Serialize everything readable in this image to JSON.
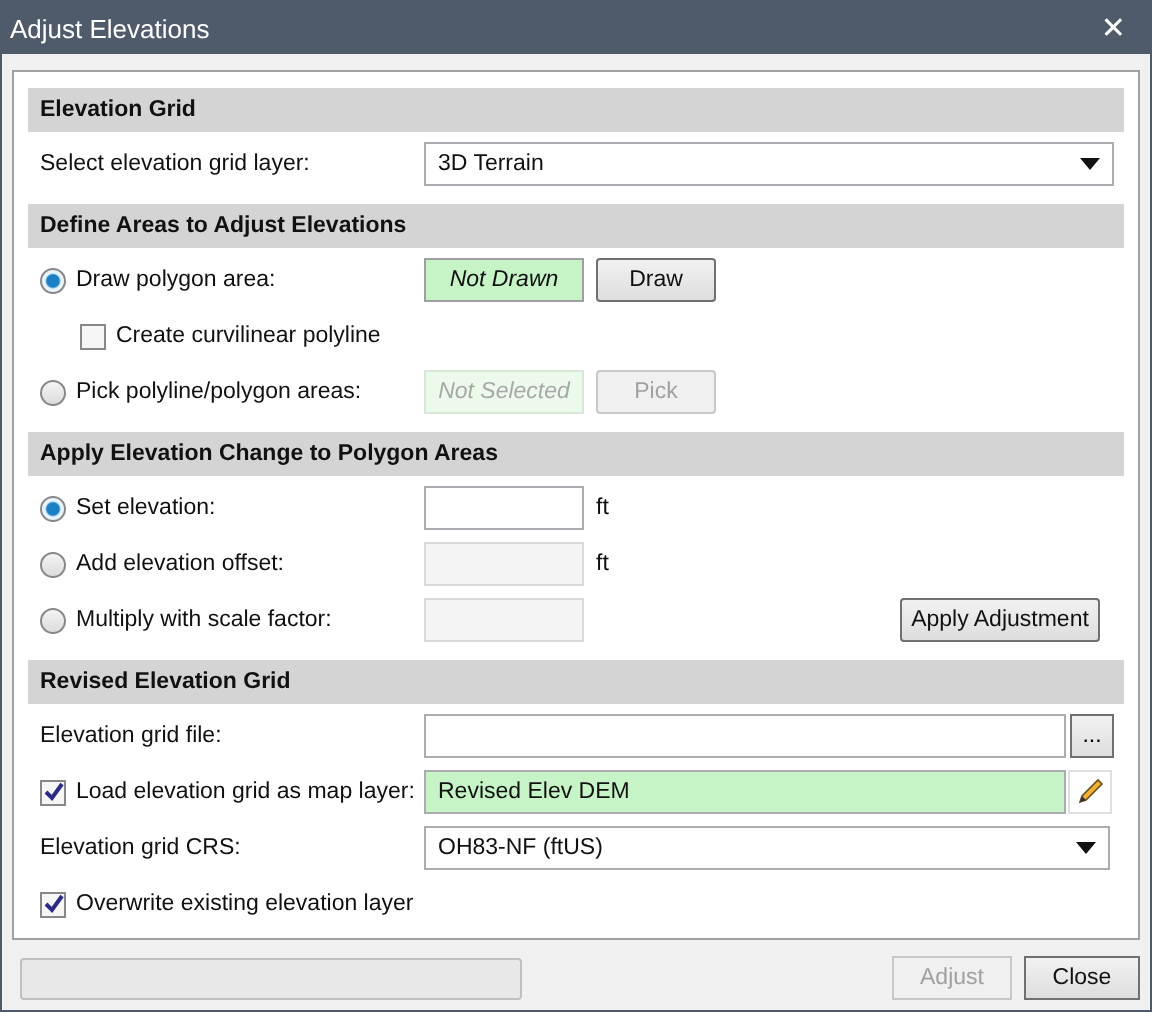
{
  "window": {
    "title": "Adjust Elevations",
    "close": "✕"
  },
  "sections": [
    {
      "title": "Elevation Grid",
      "rows": [
        {
          "kind": "dropdown",
          "label": "Select elevation grid layer:",
          "value": "3D Terrain"
        }
      ]
    },
    {
      "title": "Define Areas to Adjust Elevations",
      "rows": [
        {
          "kind": "radio_status",
          "label": "Draw polygon area:",
          "selected": true,
          "status": "Not Drawn",
          "button": "Draw",
          "disabled": false
        },
        {
          "kind": "sub_checkbox",
          "label": "Create curvilinear polyline",
          "checked": false
        },
        {
          "kind": "radio_status",
          "label": "Pick polyline/polygon areas:",
          "selected": false,
          "status": "Not Selected",
          "button": "Pick",
          "disabled": true
        }
      ]
    },
    {
      "title": "Apply Elevation Change to Polygon Areas",
      "rows": [
        {
          "kind": "radio_input",
          "label": "Set elevation:",
          "selected": true,
          "disabled": false,
          "unit": "ft"
        },
        {
          "kind": "radio_input",
          "label": "Add elevation offset:",
          "selected": false,
          "disabled": true,
          "unit": "ft"
        },
        {
          "kind": "radio_input",
          "label": "Multiply with scale factor:",
          "selected": false,
          "disabled": true,
          "button": "Apply Adjustment"
        }
      ]
    },
    {
      "title": "Revised Elevation Grid",
      "rows": [
        {
          "kind": "file",
          "label": "Elevation grid file:",
          "button": "..."
        },
        {
          "kind": "checkbox_text",
          "label": "Load elevation grid as map layer:",
          "checked": true,
          "value": "Revised Elev DEM"
        },
        {
          "kind": "dropdown",
          "label": "Elevation grid CRS:",
          "value": "OH83-NF (ftUS)"
        },
        {
          "kind": "checkbox",
          "label": "Overwrite existing elevation layer",
          "checked": true
        }
      ]
    }
  ],
  "footer": {
    "buttons": [
      {
        "label": "Adjust",
        "disabled": true
      },
      {
        "label": "Close",
        "disabled": false
      }
    ]
  }
}
